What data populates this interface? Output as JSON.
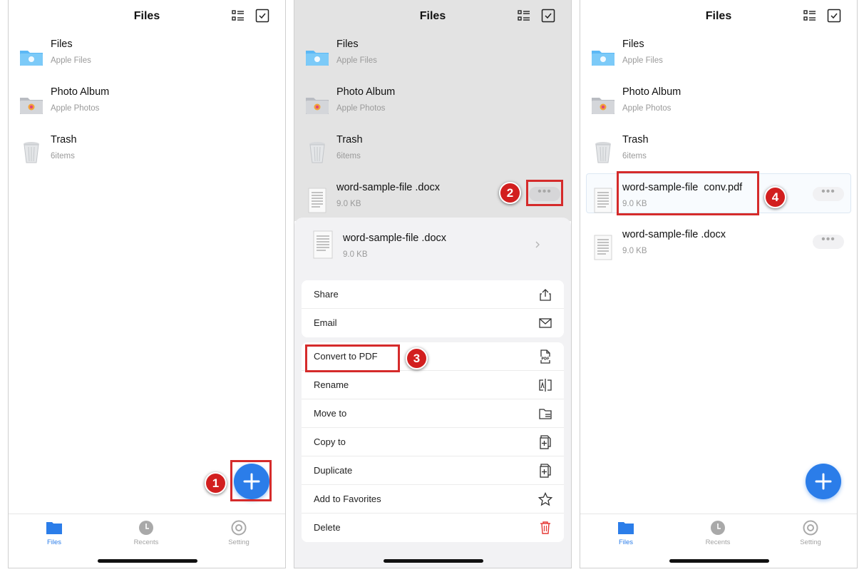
{
  "header": {
    "title": "Files"
  },
  "locations": [
    {
      "name": "Files",
      "sub": "Apple Files",
      "icon": "folder-icon"
    },
    {
      "name": "Photo Album",
      "sub": "Apple Photos",
      "icon": "photo-album-icon"
    },
    {
      "name": "Trash",
      "sub": "6items",
      "icon": "trash-can-icon"
    }
  ],
  "file_docx": {
    "name": "word-sample-file .docx",
    "size": "9.0 KB"
  },
  "file_pdf": {
    "name": "word-sample-file  conv.pdf",
    "size": "9.0 KB"
  },
  "sheet": {
    "file_name": "word-sample-file .docx",
    "file_size": "9.0 KB",
    "group1": [
      {
        "label": "Share",
        "icon": "share-icon"
      },
      {
        "label": "Email",
        "icon": "email-icon"
      }
    ],
    "group2": [
      {
        "label": "Convert to PDF",
        "icon": "pdf-icon"
      },
      {
        "label": "Rename",
        "icon": "rename-icon"
      },
      {
        "label": "Move to",
        "icon": "move-folder-icon"
      },
      {
        "label": "Copy to",
        "icon": "copy-icon"
      },
      {
        "label": "Duplicate",
        "icon": "duplicate-icon"
      },
      {
        "label": "Add to Favorites",
        "icon": "star-icon"
      },
      {
        "label": "Delete",
        "icon": "delete-icon"
      }
    ]
  },
  "tabs": [
    {
      "label": "Files",
      "icon": "folder-tab-icon",
      "active": true
    },
    {
      "label": "Recents",
      "icon": "recents-clock-icon",
      "active": false
    },
    {
      "label": "Setting",
      "icon": "gear-icon",
      "active": false
    }
  ],
  "steps": [
    "1",
    "2",
    "3",
    "4"
  ],
  "more_glyph": "•••",
  "colors": {
    "accent": "#2b7de9",
    "callout": "#d52b2b",
    "delete": "#e53935"
  }
}
